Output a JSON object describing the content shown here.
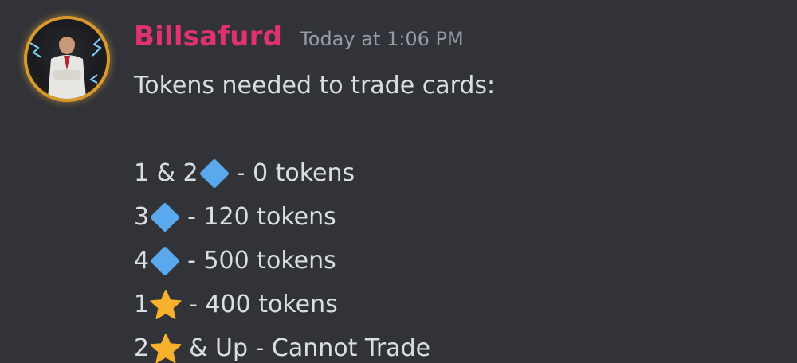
{
  "message": {
    "author": "Billsafurd",
    "timestamp": "Today at 1:06 PM",
    "author_color": "#e0326e",
    "heading": "Tokens needed to trade cards:",
    "lines": [
      {
        "prefix": "1 & 2",
        "emoji": "diamond-icon",
        "suffix": "- 0 tokens"
      },
      {
        "prefix": "3",
        "emoji": "diamond-icon",
        "suffix": "- 120 tokens"
      },
      {
        "prefix": "4",
        "emoji": "diamond-icon",
        "suffix": "- 500 tokens"
      },
      {
        "prefix": "1",
        "emoji": "star-icon",
        "suffix": "- 400 tokens"
      },
      {
        "prefix": "2",
        "emoji": "star-icon",
        "suffix": "& Up - Cannot Trade"
      }
    ]
  },
  "colors": {
    "background": "#313338",
    "text": "#dbdee1",
    "muted": "#949ba4",
    "diamond": "#5aa9ee",
    "star": "#f7b12d"
  }
}
